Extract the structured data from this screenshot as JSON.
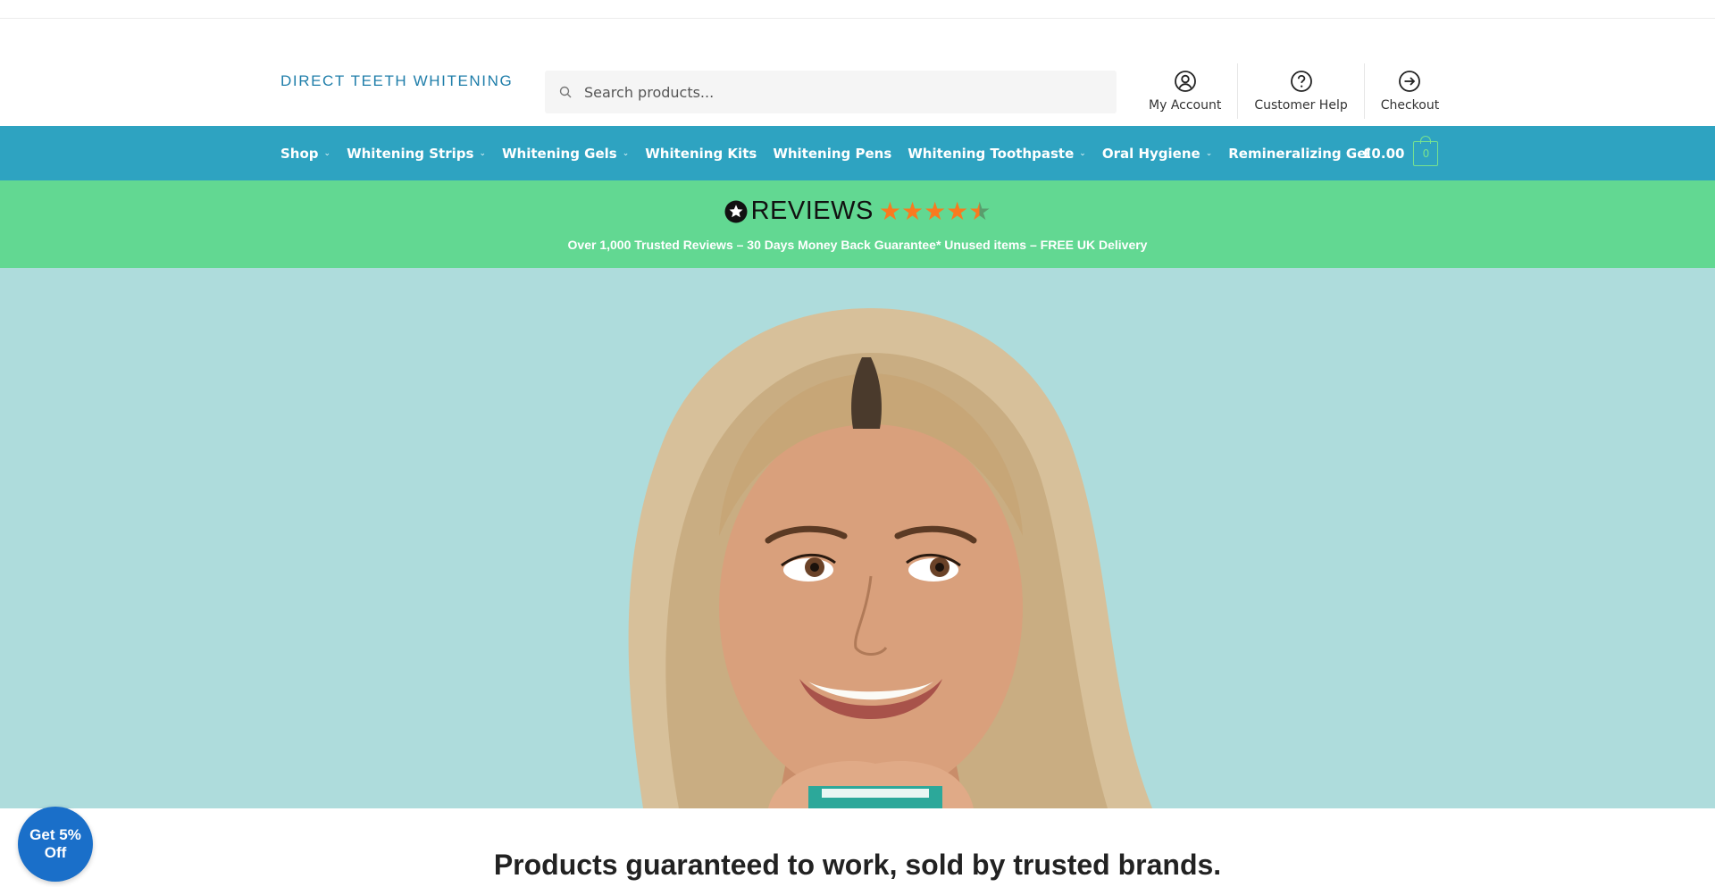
{
  "brand": {
    "logo_text": "DIRECT TEETH WHITENING"
  },
  "search": {
    "placeholder": "Search products..."
  },
  "header_links": [
    {
      "label": "My Account",
      "icon": "user-circle-icon"
    },
    {
      "label": "Customer Help",
      "icon": "question-circle-icon"
    },
    {
      "label": "Checkout",
      "icon": "arrow-right-circle-icon"
    }
  ],
  "nav": {
    "items": [
      {
        "label": "Shop",
        "has_dropdown": true
      },
      {
        "label": "Whitening Strips",
        "has_dropdown": true
      },
      {
        "label": "Whitening Gels",
        "has_dropdown": true
      },
      {
        "label": "Whitening Kits",
        "has_dropdown": false
      },
      {
        "label": "Whitening Pens",
        "has_dropdown": false
      },
      {
        "label": "Whitening Toothpaste",
        "has_dropdown": true
      },
      {
        "label": "Oral Hygiene",
        "has_dropdown": true
      },
      {
        "label": "Remineralizing Gel",
        "has_dropdown": false
      }
    ],
    "cart_total": "£0.00",
    "cart_count": "0"
  },
  "promo": {
    "reviews_word": "REVIEWS",
    "rating_stars": 4.5,
    "line": "Over 1,000 Trusted Reviews – 30 Days Money Back Guarantee* Unused items – FREE UK Delivery"
  },
  "hero": {
    "image": "woman-smiling-with-product"
  },
  "tagline": "Products guaranteed to work, sold by trusted brands.",
  "discount_badge": {
    "line1": "Get 5%",
    "line2": "Off"
  },
  "colors": {
    "nav_bg": "#2ea3c1",
    "promo_bg": "#62d892",
    "hero_bg": "#aedcdc",
    "star": "#f97a1f",
    "badge_bg": "#1a6fc9",
    "logo": "#1f7eaa"
  }
}
